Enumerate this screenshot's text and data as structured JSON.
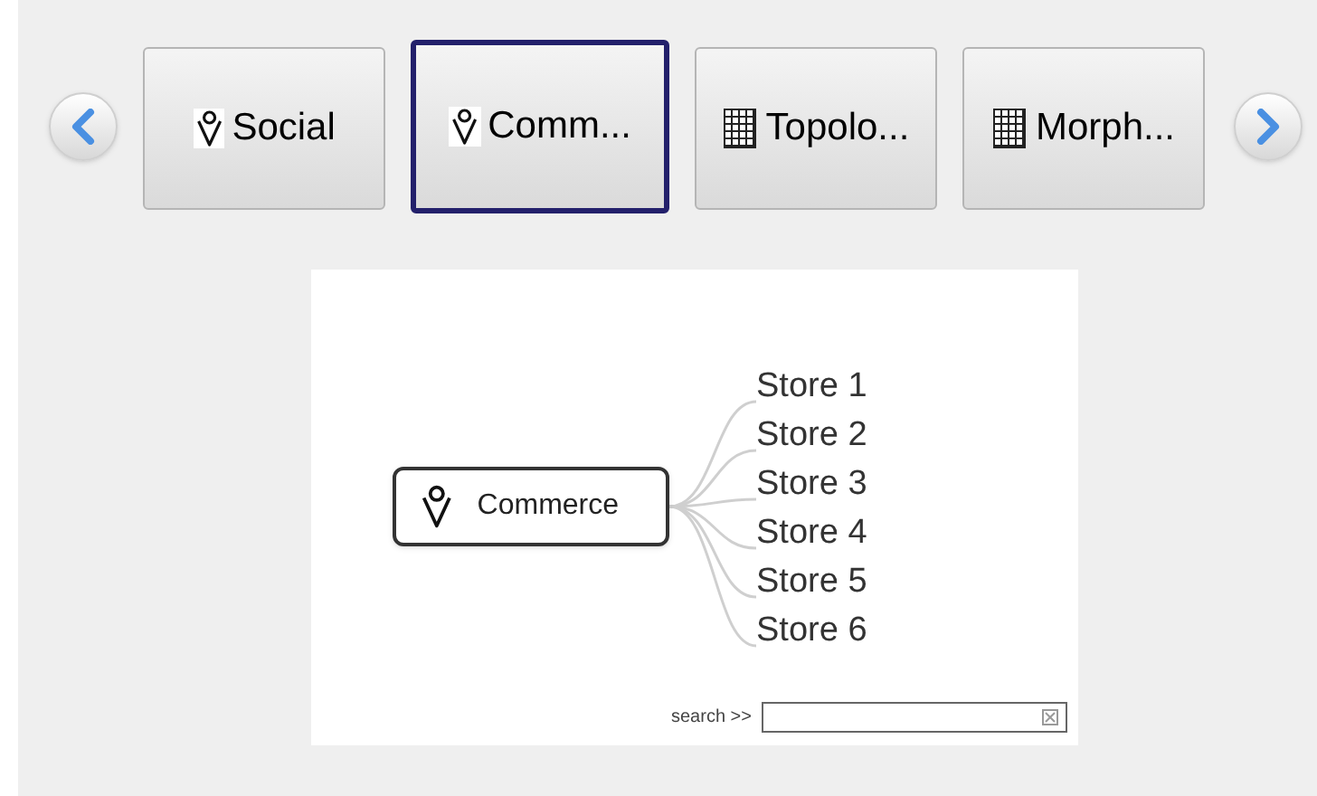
{
  "tabs": [
    {
      "label": "Social",
      "kind": "pin",
      "selected": false
    },
    {
      "label": "Comm...",
      "kind": "pin",
      "selected": true
    },
    {
      "label": "Topolo...",
      "kind": "grid",
      "selected": false
    },
    {
      "label": "Morph...",
      "kind": "grid",
      "selected": false
    }
  ],
  "diagram": {
    "root": "Commerce",
    "children": [
      "Store 1",
      "Store 2",
      "Store 3",
      "Store 4",
      "Store 5",
      "Store 6"
    ]
  },
  "search": {
    "label": "search >>"
  }
}
